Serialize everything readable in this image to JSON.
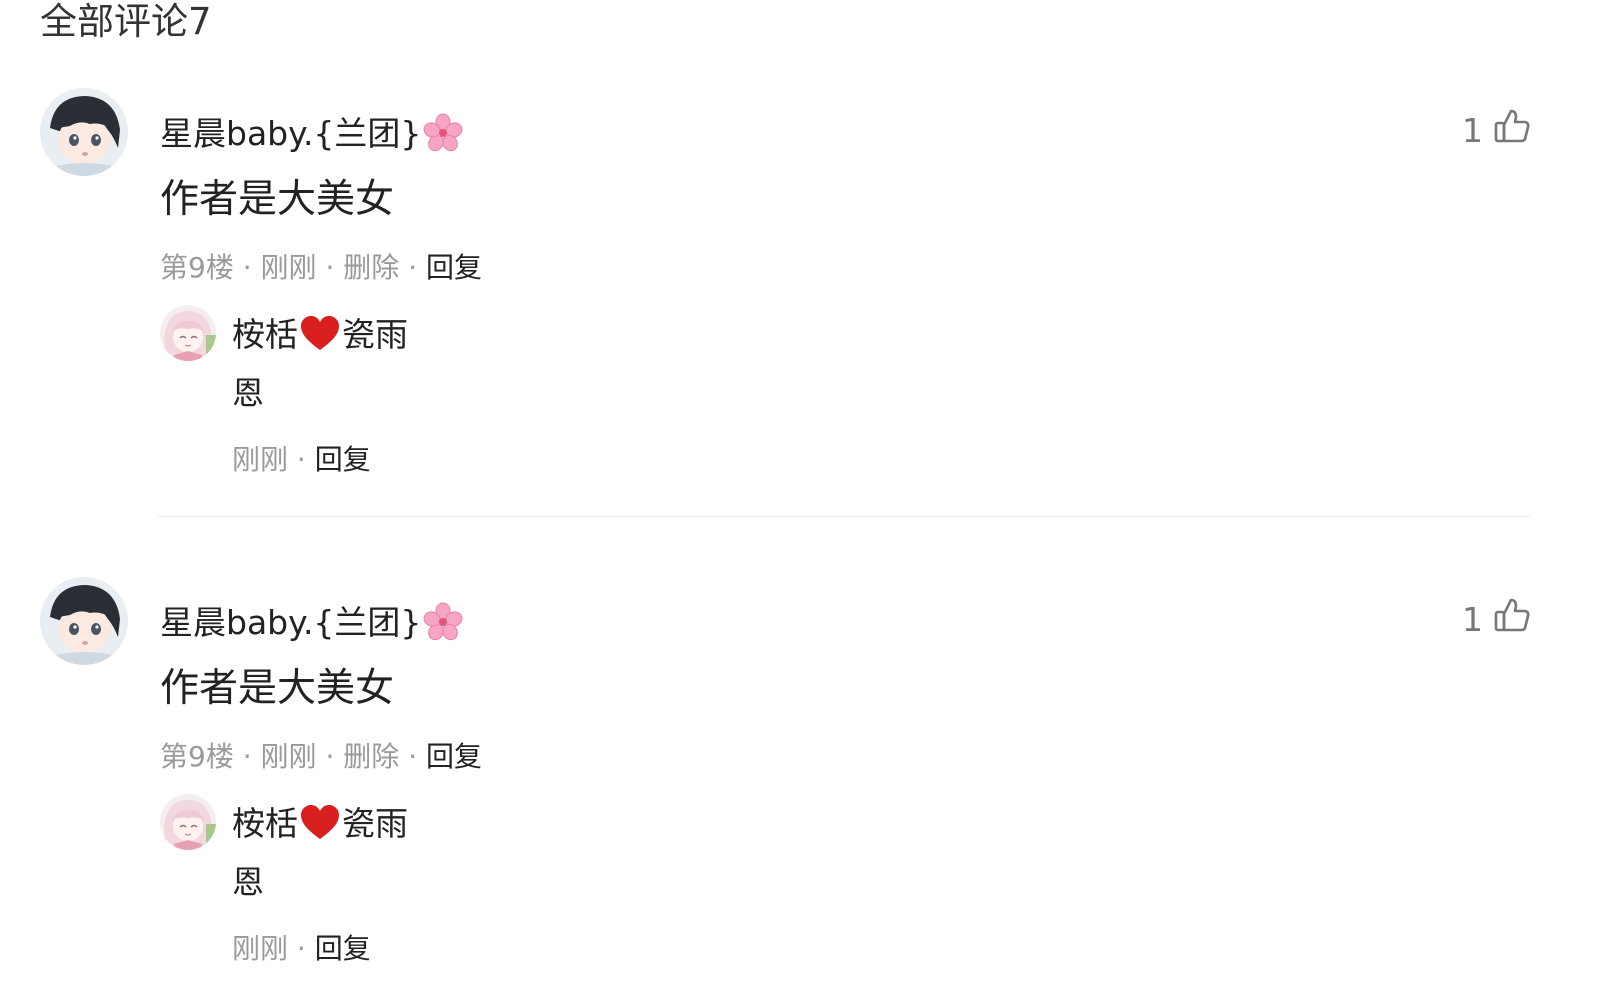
{
  "header": {
    "title": "全部评论7"
  },
  "comments": [
    {
      "username": "星晨baby.{兰团}",
      "username_emoji": "cherry-blossom",
      "like_count": "1",
      "text": "作者是大美女",
      "floor": "第9楼",
      "time": "刚刚",
      "delete_label": "删除",
      "reply_label": "回复",
      "separator": "·",
      "reply": {
        "username_part1": "桉栝",
        "username_emoji": "red-heart",
        "username_part2": "瓷雨",
        "text": "恩",
        "time": "刚刚",
        "reply_label": "回复"
      }
    },
    {
      "username": "星晨baby.{兰团}",
      "username_emoji": "cherry-blossom",
      "like_count": "1",
      "text": "作者是大美女",
      "floor": "第9楼",
      "time": "刚刚",
      "delete_label": "删除",
      "reply_label": "回复",
      "separator": "·",
      "reply": {
        "username_part1": "桉栝",
        "username_emoji": "red-heart",
        "username_part2": "瓷雨",
        "text": "恩",
        "time": "刚刚",
        "reply_label": "回复"
      }
    }
  ],
  "colors": {
    "text": "#222222",
    "meta": "#9a9a9a",
    "divider": "#ececec",
    "heart": "#d81e1e",
    "blossom": "#f48fb1"
  }
}
